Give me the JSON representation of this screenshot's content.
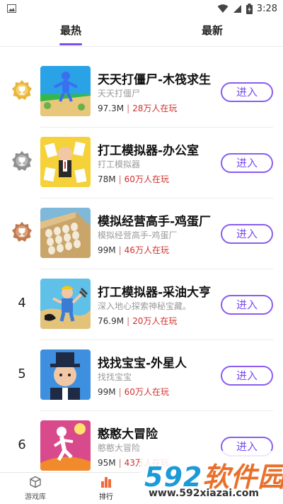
{
  "status_bar": {
    "time": "3:28"
  },
  "tabs": [
    {
      "label": "最热",
      "active": true
    },
    {
      "label": "最新",
      "active": false
    }
  ],
  "colors": {
    "accent": "#7b4cf0",
    "players": "#d0302c",
    "gold": "#e0a020",
    "silver": "#9a9a9a",
    "bronze": "#c47a4a"
  },
  "games": [
    {
      "rank": "",
      "medal": "gold-trophy-medal-icon",
      "title": "天天打僵尸-木筏求生",
      "subtitle": "天天打僵尸",
      "size": "97.3M",
      "players": "28万人在玩",
      "button": "进入"
    },
    {
      "rank": "",
      "medal": "silver-trophy-medal-icon",
      "title": "打工模拟器-办公室",
      "subtitle": "打工模拟器",
      "size": "78M",
      "players": "60万人在玩",
      "button": "进入"
    },
    {
      "rank": "",
      "medal": "bronze-trophy-medal-icon",
      "title": "模拟经营高手-鸡蛋厂",
      "subtitle": "模拟经营高手-鸡蛋厂",
      "size": "99M",
      "players": "46万人在玩",
      "button": "进入"
    },
    {
      "rank": "4",
      "medal": "",
      "title": "打工模拟器-采油大亨",
      "subtitle": "深入地心探索神秘宝藏。",
      "size": "76.9M",
      "players": "20万人在玩",
      "button": "进入"
    },
    {
      "rank": "5",
      "medal": "",
      "title": "找找宝宝-外星人",
      "subtitle": "找找宝宝",
      "size": "99M",
      "players": "60万人在玩",
      "button": "进入"
    },
    {
      "rank": "6",
      "medal": "",
      "title": "憨憨大冒险",
      "subtitle": "憨憨大冒险",
      "size": "95M",
      "players": "43万人在玩",
      "button": "进入"
    }
  ],
  "bottom_nav": [
    {
      "label": "游戏库",
      "icon": "cube-icon"
    },
    {
      "label": "排行",
      "icon": "ranking-icon"
    }
  ],
  "watermark": {
    "numbers": "592",
    "text": "软件园",
    "url": "www.592xiazai.com"
  }
}
